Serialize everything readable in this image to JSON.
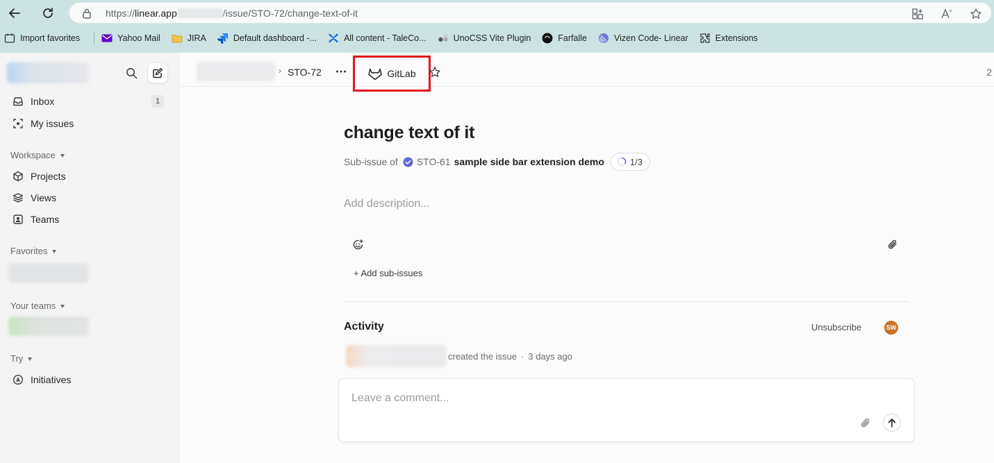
{
  "browser": {
    "url_prefix": "https://",
    "url_host": "linear.app",
    "url_path": "/issue/STO-72/change-text-of-it",
    "bookmarks": [
      {
        "label": "Import favorites",
        "icon": "import-icon"
      },
      {
        "label": "Yahoo Mail",
        "icon": "yahoo-mail-icon"
      },
      {
        "label": "JIRA",
        "icon": "folder-icon"
      },
      {
        "label": "Default dashboard -...",
        "icon": "jira-icon"
      },
      {
        "label": "All content - TaleCo...",
        "icon": "confluence-icon"
      },
      {
        "label": "UnoCSS Vite Plugin",
        "icon": "unocss-icon"
      },
      {
        "label": "Farfalle",
        "icon": "farfalle-icon"
      },
      {
        "label": "Vizen Code- Linear",
        "icon": "linear-icon"
      },
      {
        "label": "Extensions",
        "icon": "extensions-icon"
      }
    ]
  },
  "sidebar": {
    "inbox": {
      "label": "Inbox",
      "count": "1"
    },
    "my_issues": {
      "label": "My issues"
    },
    "workspace_label": "Workspace",
    "workspace_items": [
      {
        "label": "Projects",
        "icon": "cube-icon"
      },
      {
        "label": "Views",
        "icon": "layers-icon"
      },
      {
        "label": "Teams",
        "icon": "team-icon"
      }
    ],
    "favorites_label": "Favorites",
    "your_teams_label": "Your teams",
    "try_label": "Try",
    "try_items": [
      {
        "label": "Initiatives",
        "icon": "initiatives-icon"
      }
    ]
  },
  "topbar": {
    "issue_id": "STO-72",
    "gitlab_label": "GitLab",
    "right_count": "2"
  },
  "issue": {
    "title": "change text of it",
    "sub_issue_of": "Sub-issue of",
    "parent_id": "STO-61",
    "parent_title": "sample side bar extension demo",
    "progress": "1/3",
    "description_placeholder": "Add description...",
    "add_sub_issues": "+ Add sub-issues"
  },
  "activity": {
    "title": "Activity",
    "unsubscribe": "Unsubscribe",
    "avatar_initials": "SW",
    "event_text": "created the issue",
    "event_sep": "·",
    "event_time": "3 days ago",
    "comment_placeholder": "Leave a comment..."
  },
  "colors": {
    "chrome_bg": "#cde3e3",
    "sidebar_bg": "#f4f4f5",
    "highlight_red": "#e4161b",
    "avatar_orange": "#c8742a",
    "parent_check_blue": "#5e6ad2"
  }
}
